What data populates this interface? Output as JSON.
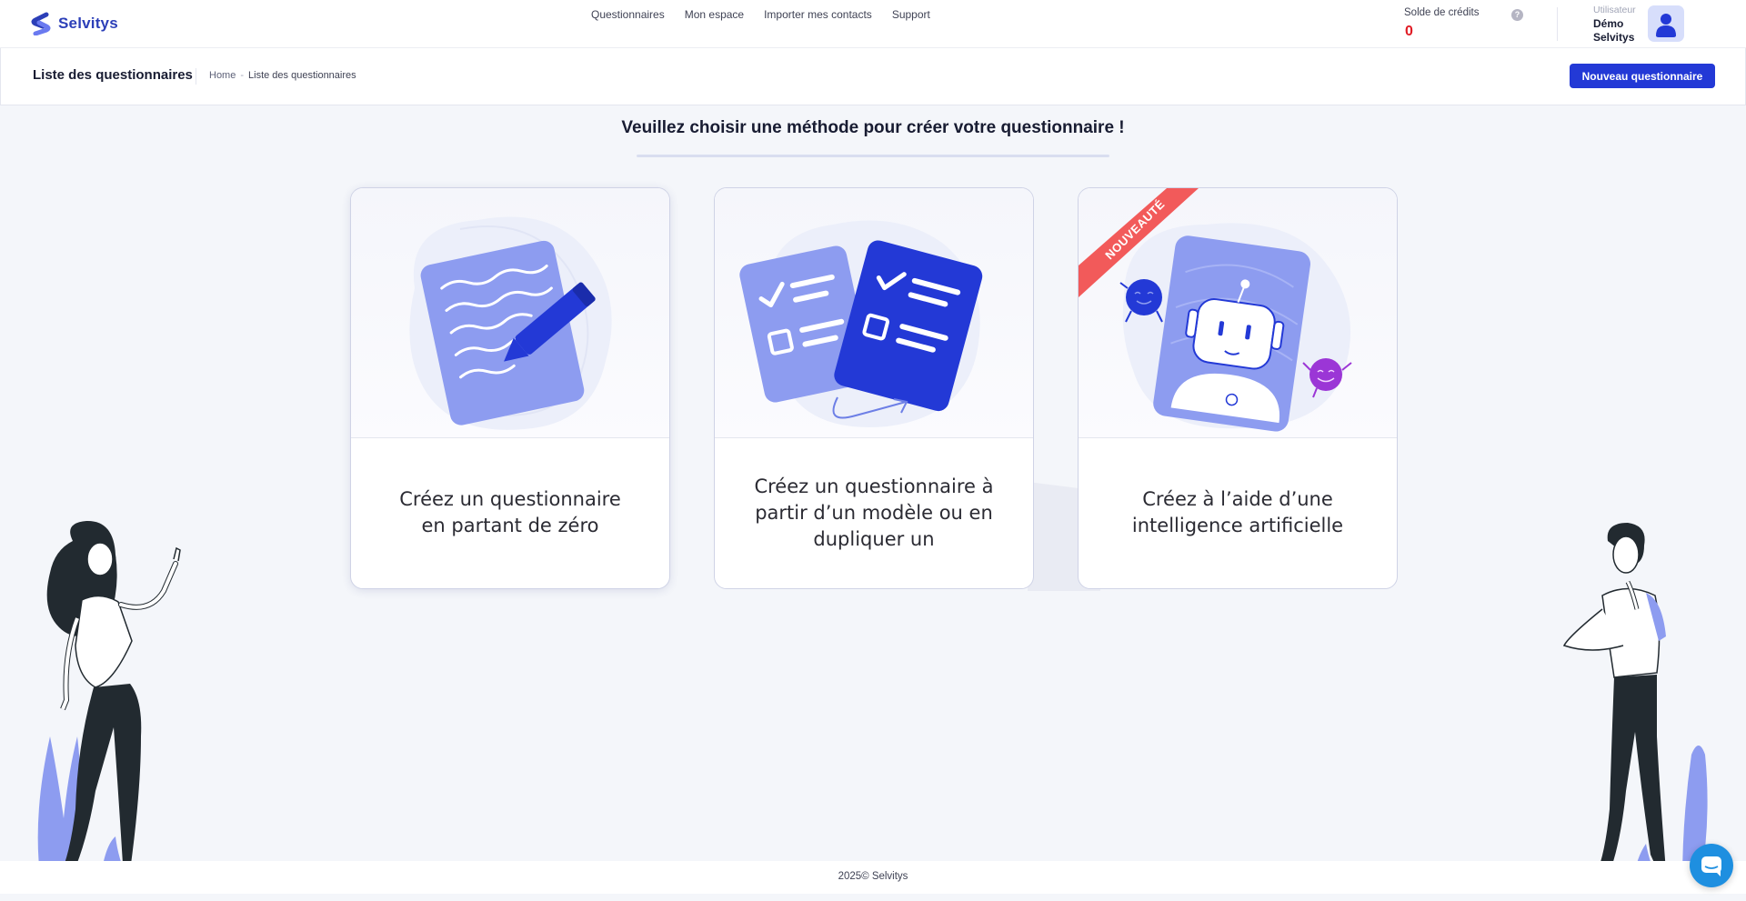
{
  "brand": {
    "name": "Selvitys"
  },
  "nav": {
    "items": [
      {
        "label": "Questionnaires"
      },
      {
        "label": "Mon espace"
      },
      {
        "label": "Importer mes contacts"
      },
      {
        "label": "Support"
      }
    ]
  },
  "credits": {
    "label": "Solde de crédits",
    "value": "0"
  },
  "user": {
    "role": "Utilisateur",
    "first_name": "Démo",
    "last_name": "Selvitys"
  },
  "toolbar": {
    "title": "Liste des questionnaires",
    "breadcrumb": {
      "home": "Home",
      "separator": "-",
      "current": "Liste des questionnaires"
    },
    "new_button": "Nouveau questionnaire"
  },
  "main": {
    "heading": "Veuillez choisir une méthode pour créer votre questionnaire !",
    "cards": [
      {
        "lines": [
          "Créez un questionnaire",
          "en partant de zéro"
        ]
      },
      {
        "lines": [
          "Créez un questionnaire à",
          "partir d’un modèle ou en",
          "dupliquer un"
        ]
      },
      {
        "lines": [
          "Créez à l’aide d’une",
          "intelligence artificielle"
        ],
        "ribbon": "NOUVEAUTÉ"
      }
    ]
  },
  "footer": {
    "text": "2025© Selvitys"
  },
  "colors": {
    "primary": "#2339d6",
    "primary_light": "#8d9cf0",
    "credits_red": "#e01b24",
    "ribbon": "#f25a5a",
    "ai_purple": "#9b36d6"
  },
  "icons": {
    "help": "help-icon",
    "avatar": "user-icon",
    "chat": "chat-icon"
  }
}
